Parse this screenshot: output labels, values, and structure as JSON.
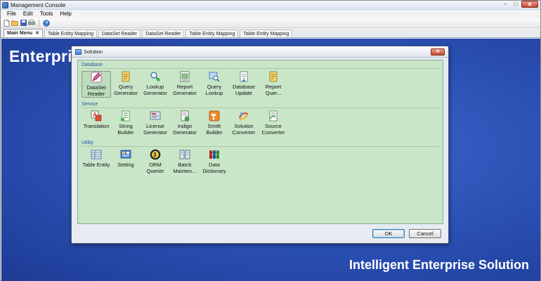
{
  "window": {
    "title": "Management Console",
    "controls": {
      "minimize": "–",
      "maximize": "□",
      "close": "✕"
    }
  },
  "menu": [
    "File",
    "Edit",
    "Tools",
    "Help"
  ],
  "toolbar": {
    "icons": [
      "new-file-icon",
      "open-folder-icon",
      "save-icon",
      "print-icon",
      "help-icon"
    ]
  },
  "tabs": [
    {
      "label": "Main Menu",
      "active": true,
      "close": "✕"
    },
    {
      "label": "Table Entity Mapping"
    },
    {
      "label": "DataSet Reader"
    },
    {
      "label": "DataSet Reader"
    },
    {
      "label": "Table Entity Mapping"
    },
    {
      "label": "Table Entity Mapping"
    }
  ],
  "background": {
    "title": "Enterprise Solution",
    "footer": "Intelligent Enterprise Solution"
  },
  "dialog": {
    "title": "Solution",
    "close": "✕",
    "sections": [
      {
        "label": "Database",
        "items": [
          {
            "label": "DataSet\nReader",
            "icon": "pencil-icon",
            "selected": true
          },
          {
            "label": "Query\nGenerator",
            "icon": "query-generator-icon"
          },
          {
            "label": "Lookup\nGenerator",
            "icon": "lookup-generator-icon"
          },
          {
            "label": "Report\nGenerator",
            "icon": "report-generator-icon"
          },
          {
            "label": "Query\nLookup",
            "icon": "query-lookup-icon"
          },
          {
            "label": "Database\nUpdate",
            "icon": "database-update-icon"
          },
          {
            "label": "Report\nQuer...",
            "icon": "report-query-icon"
          }
        ]
      },
      {
        "label": "Service",
        "items": [
          {
            "label": "Translation",
            "icon": "translation-icon"
          },
          {
            "label": "String\nBuilder",
            "icon": "string-builder-icon"
          },
          {
            "label": "License\nGenerator",
            "icon": "license-generator-icon"
          },
          {
            "label": "Indigo\nGenerator",
            "icon": "indigo-generator-icon"
          },
          {
            "label": "Smith\nBuilder",
            "icon": "hammer-icon"
          },
          {
            "label": "Solution\nConverter",
            "icon": "solution-converter-icon"
          },
          {
            "label": "Source\nConverter",
            "icon": "source-converter-icon"
          }
        ]
      },
      {
        "label": "Utility",
        "items": [
          {
            "label": "Table Entity",
            "icon": "table-entity-icon"
          },
          {
            "label": "Setting",
            "icon": "setting-icon"
          },
          {
            "label": "ORM\nQuerier",
            "icon": "orm-querier-icon"
          },
          {
            "label": "Batch\nMainten...",
            "icon": "batch-maintenance-icon"
          },
          {
            "label": "Data\nDictionary",
            "icon": "data-dictionary-icon"
          }
        ]
      }
    ],
    "buttons": {
      "ok": "OK",
      "cancel": "Cancel"
    }
  },
  "colors": {
    "desktop_bg": "#2a4fb2",
    "panel_bg": "#c9e6c9",
    "section_label": "#2552a8",
    "accent_close": "#c5472f"
  }
}
